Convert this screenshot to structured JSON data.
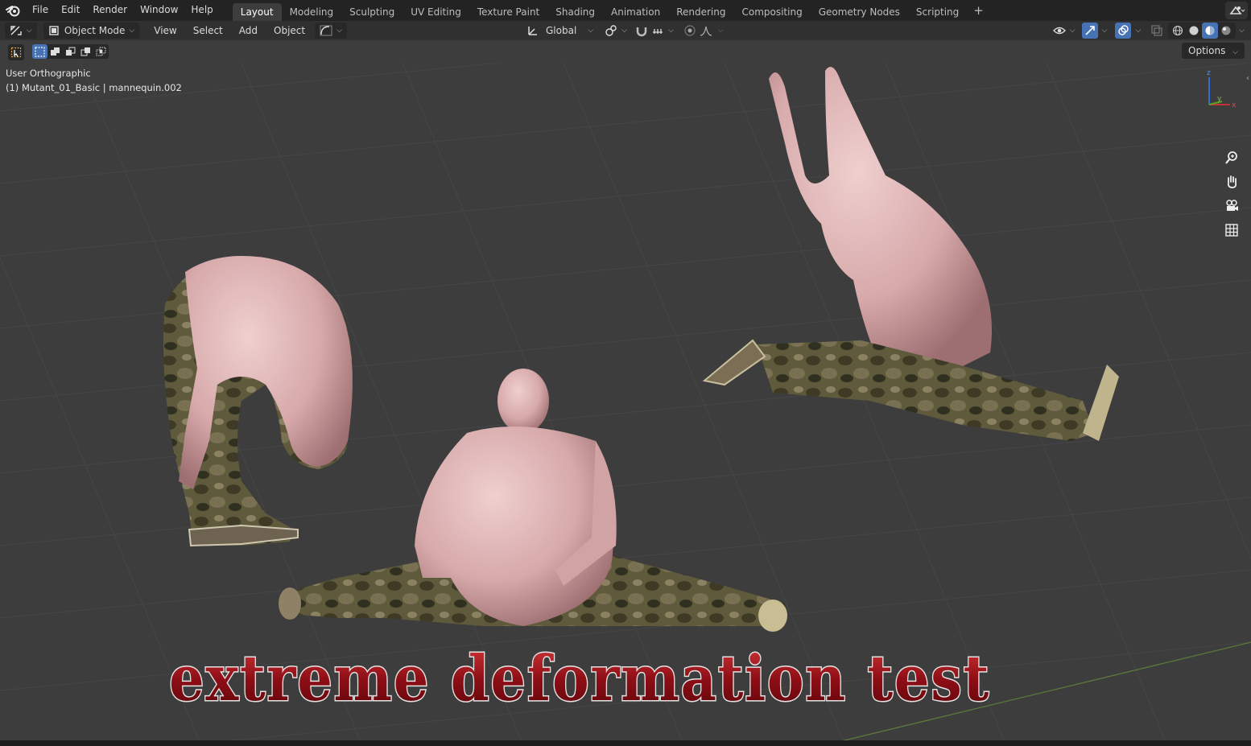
{
  "topbar": {
    "menus": [
      "File",
      "Edit",
      "Render",
      "Window",
      "Help"
    ],
    "workspaces": [
      "Layout",
      "Modeling",
      "Sculpting",
      "UV Editing",
      "Texture Paint",
      "Shading",
      "Animation",
      "Rendering",
      "Compositing",
      "Geometry Nodes",
      "Scripting"
    ],
    "active_workspace": "Layout",
    "add_tab": "+"
  },
  "header": {
    "mode": "Object Mode",
    "menus": [
      "View",
      "Select",
      "Add",
      "Object"
    ],
    "transform_orientation": "Global"
  },
  "toolrow": {
    "options_label": "Options"
  },
  "viewport": {
    "view_name": "User Orthographic",
    "object_info": "(1) Mutant_01_Basic | mannequin.002",
    "axis_labels": {
      "z": "z",
      "y": "y",
      "x": "x"
    },
    "overlay_text": "extreme deformation test",
    "figures": [
      "crouching-figure",
      "sitting-splits-figure",
      "leaping-figure"
    ]
  },
  "colors": {
    "topbar_bg": "#232323",
    "header_bg": "#303030",
    "viewport_bg": "#3d3d3d",
    "accent_blue": "#4772b3",
    "title_red": "#a0121a",
    "title_outline": "#d9d9d9"
  }
}
